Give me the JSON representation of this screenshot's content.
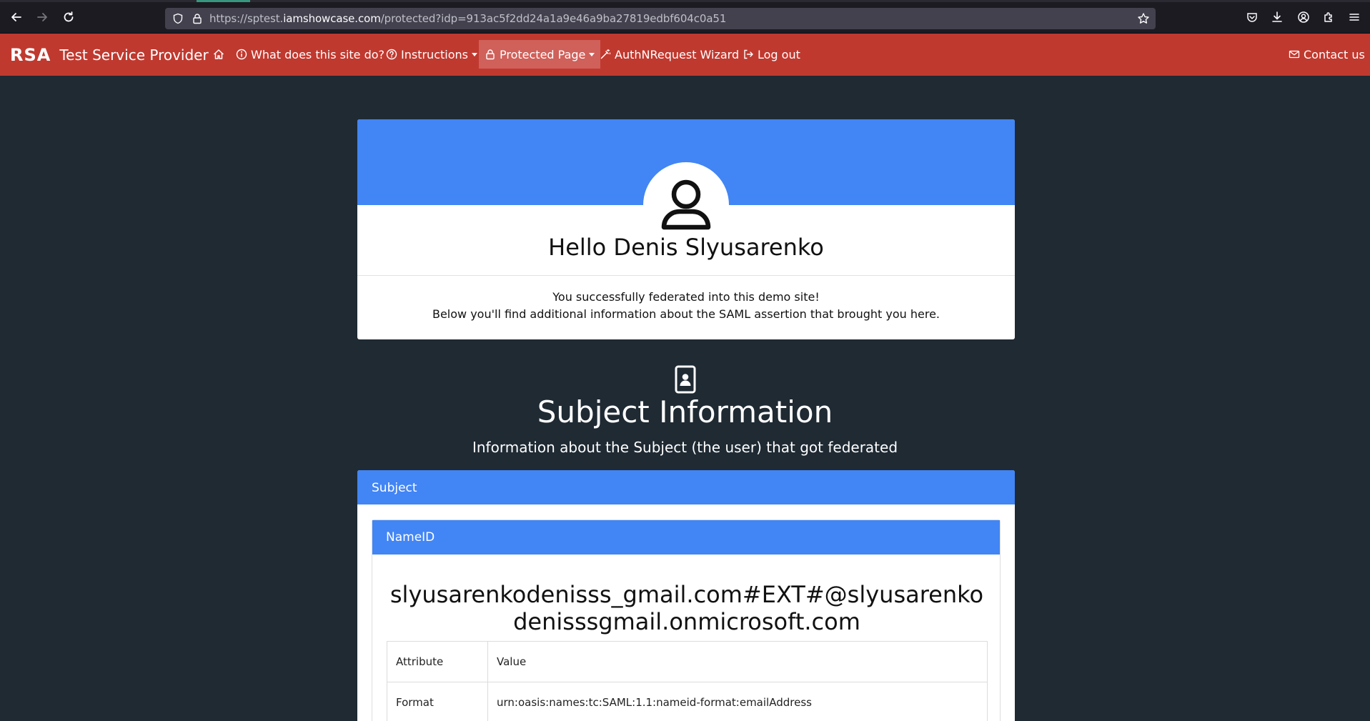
{
  "browser": {
    "url_prefix": "https://sptest.",
    "url_host": "iamshowcase.com",
    "url_path": "/protected?idp=913ac5f2dd24a1a9e46a9ba27819edbf604c0a51",
    "icons": [
      "back-icon",
      "forward-icon",
      "reload-icon",
      "shield-icon",
      "lock-icon",
      "bookmark-star-icon",
      "pocket-icon",
      "download-icon",
      "account-icon",
      "extensions-icon",
      "menu-icon"
    ]
  },
  "navbar": {
    "brand_logo": "RSA",
    "brand_name": "Test Service Provider",
    "items": [
      {
        "label": "What does this site do?",
        "icon": "info-icon"
      },
      {
        "label": "Instructions",
        "icon": "question-icon"
      },
      {
        "label": "Protected Page",
        "icon": "lock-icon"
      },
      {
        "label": "AuthNRequest Wizard",
        "icon": "wand-icon"
      },
      {
        "label": "Log out",
        "icon": "logout-icon"
      }
    ],
    "contact": "Contact us",
    "colors": {
      "bar": "#c0392f",
      "active": "#d0605a"
    }
  },
  "hello": {
    "title": "Hello Denis Slyusarenko",
    "line1": "You successfully federated into this demo site!",
    "line2": "Below you'll find additional information about the SAML assertion that brought you here."
  },
  "subject_section": {
    "title": "Subject Information",
    "subtitle": "Information about the Subject (the user) that got federated",
    "card_header": "Subject",
    "nameid_header": "NameID",
    "nameid_value": "slyusarenkodenisss_gmail.com#EXT#@slyusarenkodenisssgmail.onmicrosoft.com",
    "table": {
      "headers": [
        "Attribute",
        "Value"
      ],
      "rows": [
        [
          "Format",
          "urn:oasis:names:tc:SAML:1.1:nameid-format:emailAddress"
        ]
      ]
    },
    "accent": "#4285f4"
  }
}
